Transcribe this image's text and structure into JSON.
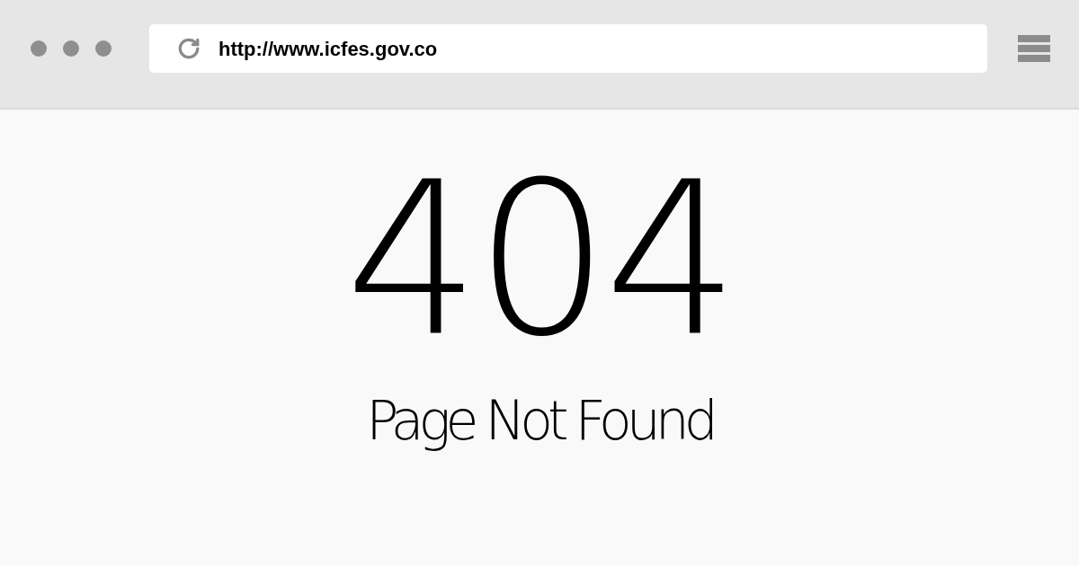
{
  "browser": {
    "url": "http://www.icfes.gov.co"
  },
  "error": {
    "code": "404",
    "message": "Page Not Found"
  }
}
